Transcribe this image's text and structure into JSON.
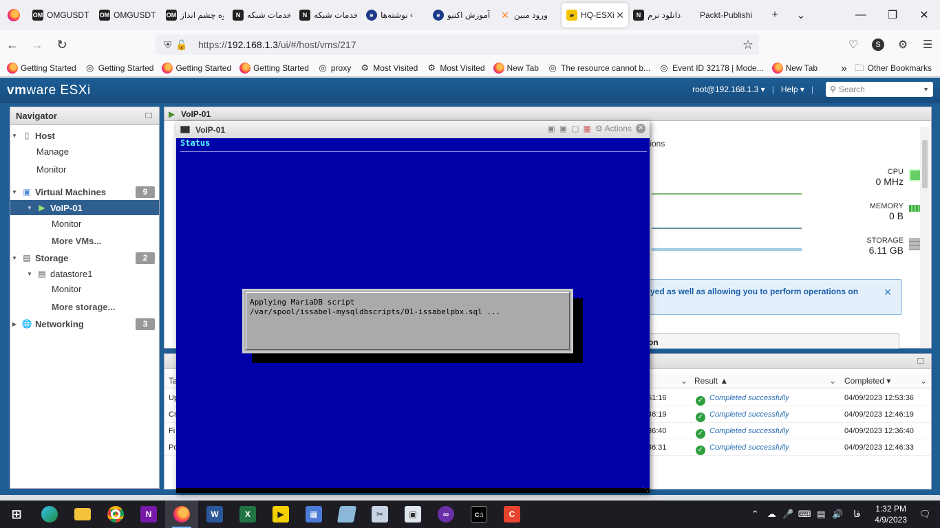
{
  "browser": {
    "tabs": [
      {
        "favicon": "OM",
        "label": "OMGUSDT"
      },
      {
        "favicon": "OM",
        "label": "OMGUSDT"
      },
      {
        "favicon": "OM",
        "label": "گروه چشم انداز"
      },
      {
        "favicon": "N",
        "label": "خدمات شبکه"
      },
      {
        "favicon": "N",
        "label": "خدمات شبکه"
      },
      {
        "favicon": "e",
        "label": "نوشته‌ها ‹"
      },
      {
        "favicon": "e",
        "label": "آموزش اکتیو"
      },
      {
        "favicon": "✕",
        "label": "ورود مبین"
      },
      {
        "favicon": "▰",
        "label": "HQ-ESXi",
        "active": true,
        "close": "✕"
      },
      {
        "favicon": "N",
        "label": "دانلود نرم"
      },
      {
        "favicon": "",
        "label": "Packt-Publishi"
      }
    ],
    "new_tab": "+",
    "tab_list": "⌄",
    "url": {
      "prefix": "https://",
      "host": "192.168.1.3",
      "path": "/ui/#/host/vms/217"
    },
    "profile_letter": "S",
    "bookmarks": [
      {
        "icon": "firefox",
        "label": "Getting Started"
      },
      {
        "icon": "globe",
        "label": "Getting Started"
      },
      {
        "icon": "firefox",
        "label": "Getting Started"
      },
      {
        "icon": "firefox",
        "label": "Getting Started"
      },
      {
        "icon": "globe",
        "label": "proxy"
      },
      {
        "icon": "gear",
        "label": "Most Visited"
      },
      {
        "icon": "gear",
        "label": "Most Visited"
      },
      {
        "icon": "firefox",
        "label": "New Tab"
      },
      {
        "icon": "globe",
        "label": "The resource cannot b..."
      },
      {
        "icon": "globe",
        "label": "Event ID 32178 | Mode..."
      },
      {
        "icon": "firefox",
        "label": "New Tab"
      }
    ],
    "other_bookmarks": "Other Bookmarks",
    "overflow": "»"
  },
  "esxi": {
    "logo_vm": "vm",
    "logo_ware": "ware",
    "logo_product": " ESXi",
    "user": "root@192.168.1.3 ▾",
    "help": "Help ▾",
    "search_placeholder": "Search",
    "navigator": {
      "title": "Navigator",
      "host": "Host",
      "manage": "Manage",
      "monitor": "Monitor",
      "vms": "Virtual Machines",
      "vms_count": "9",
      "vm_selected": "VoIP-01",
      "vm_monitor": "Monitor",
      "more_vms": "More VMs...",
      "storage": "Storage",
      "storage_count": "2",
      "datastore": "datastore1",
      "ds_monitor": "Monitor",
      "more_storage": "More storage...",
      "networking": "Networking",
      "networking_count": "3"
    },
    "vm_panel": {
      "title": "VoIP-01",
      "actions_fragment": "tions",
      "cpu_label": "CPU",
      "cpu_value": "0 MHz",
      "memory_label": "MEMORY",
      "memory_value": "0 B",
      "storage_label": "STORAGE",
      "storage_value": "6.11 GB",
      "info_text": "yed as well as allowing you to perform operations on",
      "info_close": "✕",
      "tab_fragment": "on"
    },
    "tasks": {
      "col_task_fragment": "Ta",
      "col_result": "Result ▲",
      "col_completed": "Completed ▾",
      "rows": [
        {
          "task": "Up",
          "queued": "51:16",
          "result": "Completed successfully",
          "completed": "04/09/2023 12:53:36"
        },
        {
          "task": "Cr",
          "queued": "46:19",
          "result": "Completed successfully",
          "completed": "04/09/2023 12:46:19"
        },
        {
          "task": "Fi",
          "queued": "36:40",
          "result": "Completed successfully",
          "completed": "04/09/2023 12:36:40"
        },
        {
          "task": "Po",
          "queued": "46:31",
          "result": "Completed successfully",
          "completed": "04/09/2023 12:46:33"
        }
      ]
    }
  },
  "console": {
    "title": "VoIP-01",
    "actions": "Actions",
    "screen_header": "Status",
    "dialog_line1": "Applying MariaDB script",
    "dialog_line2": "/var/spool/issabel-mysqldbscripts/01-issabelpbx.sql ..."
  },
  "taskbar": {
    "lang": "فا",
    "time": "1:32 PM",
    "date": "4/9/2023"
  }
}
